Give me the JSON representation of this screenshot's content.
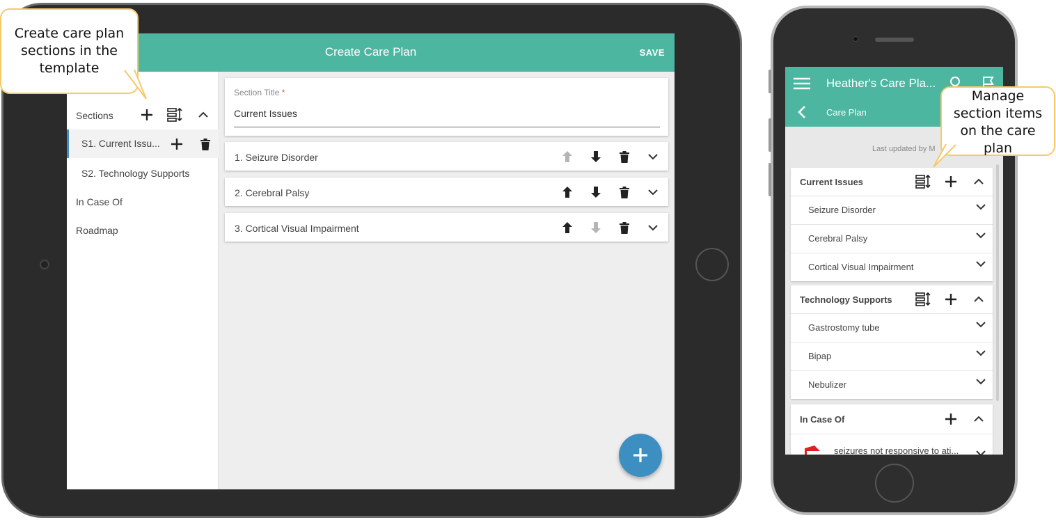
{
  "tablet": {
    "header": {
      "title": "Create Care Plan",
      "save_label": "SAVE"
    },
    "sidebar": {
      "heading": "Sections",
      "items": [
        {
          "label": "S1. Current Issu..."
        },
        {
          "label": "S2. Technology Supports"
        },
        {
          "label": "In Case Of"
        },
        {
          "label": "Roadmap"
        }
      ]
    },
    "section_title": {
      "label": "Section Title",
      "required_mark": "*",
      "value": "Current Issues"
    },
    "items": [
      {
        "label": "1. Seizure Disorder"
      },
      {
        "label": "2. Cerebral Palsy"
      },
      {
        "label": "3. Cortical Visual Impairment"
      }
    ],
    "fab_icon": "plus-icon"
  },
  "phone": {
    "header": {
      "title": "Heather's Care Pla...",
      "subtitle": "Care Plan"
    },
    "last_updated": "Last updated by M",
    "sections": [
      {
        "title": "Current Issues",
        "items": [
          "Seizure Disorder",
          "Cerebral Palsy",
          "Cortical Visual Impairment"
        ]
      },
      {
        "title": "Technology Supports",
        "items": [
          "Gastrostomy tube",
          "Bipap",
          "Nebulizer"
        ]
      },
      {
        "title": "In Case Of",
        "items": [
          "seizures not responsive to ati..."
        ]
      }
    ]
  },
  "callouts": {
    "left": [
      "Create care plan",
      "sections in the",
      "template"
    ],
    "right": [
      "Manage",
      "section items",
      "on the care",
      "plan"
    ]
  },
  "colors": {
    "header": "#4db6a0",
    "fab": "#3e8fc1",
    "callout_border": "#f5c96a",
    "flag": "#e02020"
  }
}
